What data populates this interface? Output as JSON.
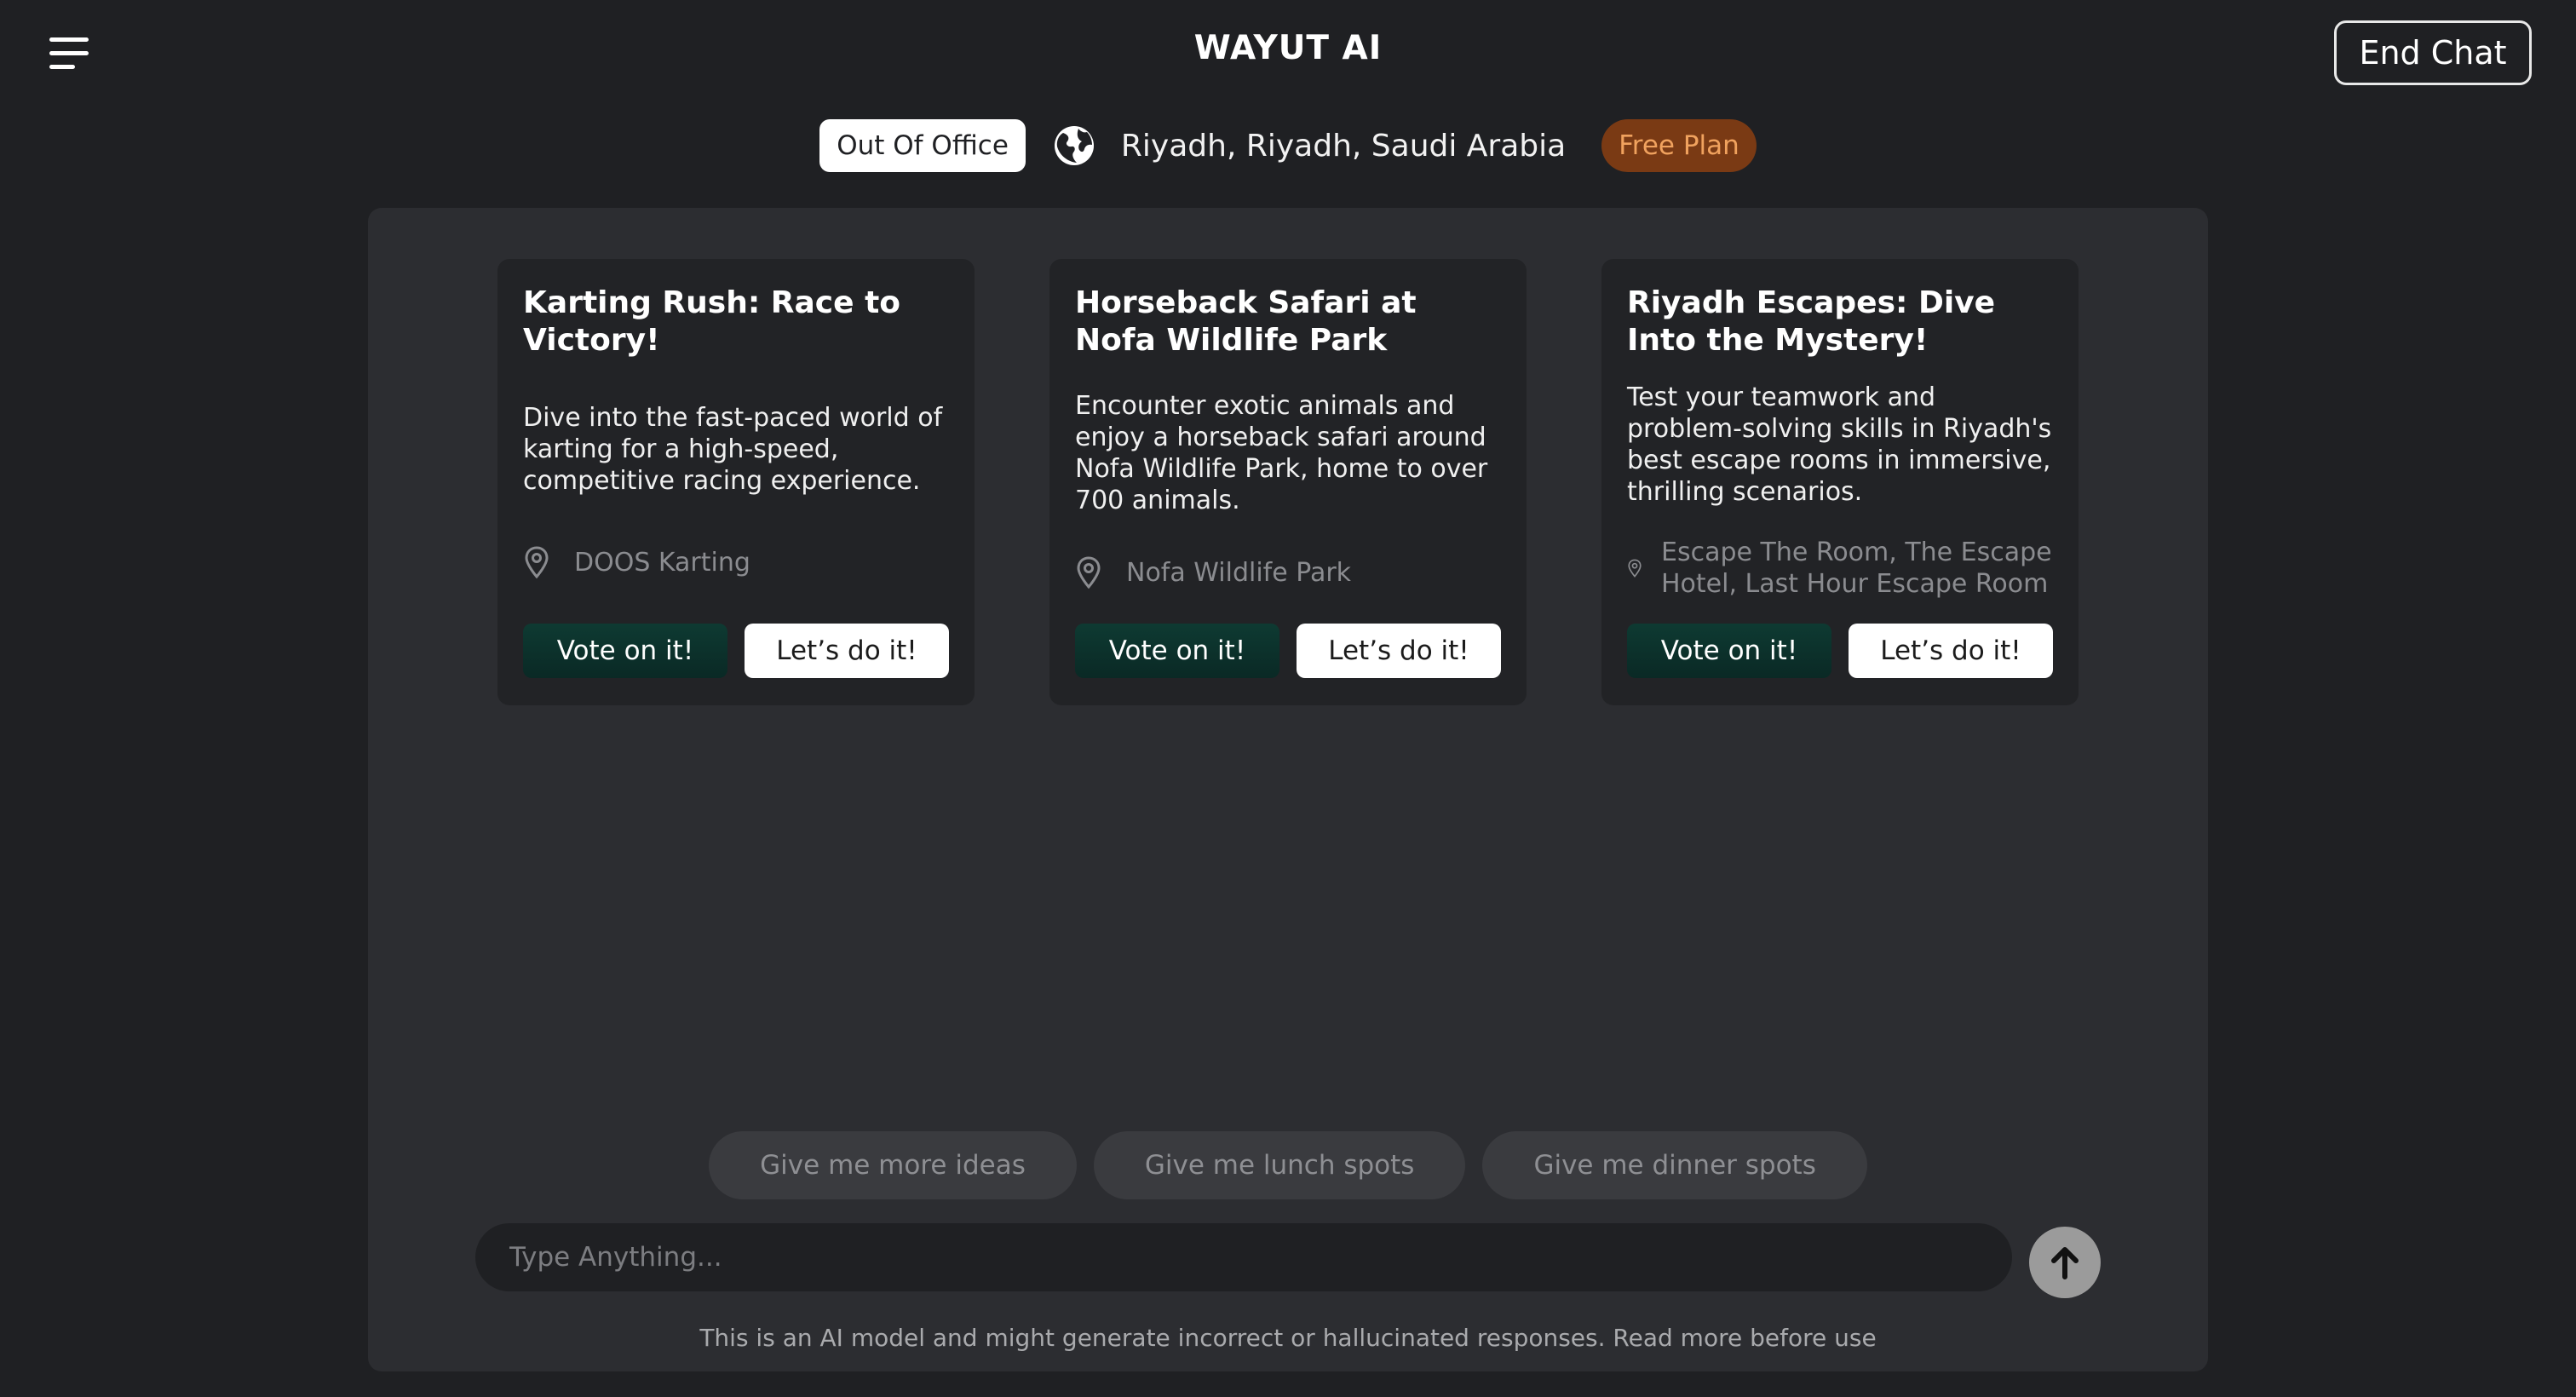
{
  "header": {
    "title": "WAYUT AI",
    "end_chat_label": "End Chat"
  },
  "status": {
    "mode_badge": "Out Of Office",
    "location": "Riyadh, Riyadh, Saudi Arabia",
    "plan_badge": "Free Plan"
  },
  "cards": [
    {
      "title": "Karting Rush: Race to Victory!",
      "description": "Dive into the fast-paced world of karting for a high-speed, competitive racing experience.",
      "location": "DOOS Karting",
      "vote_label": "Vote on it!",
      "do_label": "Let’s do it!"
    },
    {
      "title": "Horseback Safari at Nofa Wildlife Park",
      "description": "Encounter exotic animals and enjoy a horseback safari around Nofa Wildlife Park, home to over 700 animals.",
      "location": "Nofa Wildlife Park",
      "vote_label": "Vote on it!",
      "do_label": "Let’s do it!"
    },
    {
      "title": "Riyadh Escapes: Dive Into the Mystery!",
      "description": "Test your teamwork and problem-solving skills in Riyadh's best escape rooms in immersive, thrilling scenarios.",
      "location": "Escape The Room, The Escape Hotel, Last Hour Escape Room",
      "vote_label": "Vote on it!",
      "do_label": "Let’s do it!"
    }
  ],
  "suggestions": [
    "Give me more ideas",
    "Give me lunch spots",
    "Give me dinner spots"
  ],
  "input": {
    "placeholder": "Type Anything..."
  },
  "disclaimer": "This is an AI model and might generate incorrect or hallucinated responses. Read more before use",
  "icons": {
    "menu": "menu-icon",
    "globe": "globe-icon",
    "pin": "map-pin-icon",
    "send": "arrow-up-icon"
  },
  "colors": {
    "background": "#1f2023",
    "panel": "#2c2d31",
    "card": "#222326",
    "vote_button": "#0e3a32",
    "plan_badge_bg": "#7a3a14",
    "plan_badge_text": "#f0a25e"
  }
}
